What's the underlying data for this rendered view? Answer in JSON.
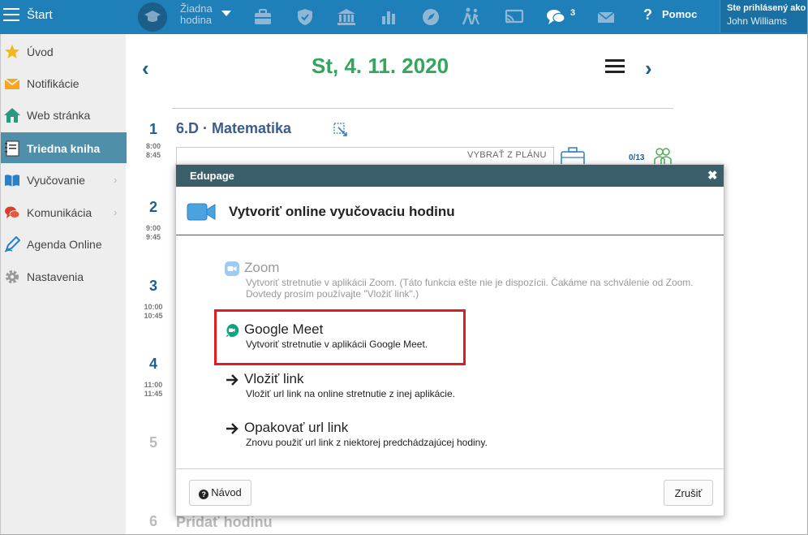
{
  "topbar": {
    "start_label": "Štart",
    "lesson_label": "Žiadna hodina",
    "chat_count": "3",
    "help_label": "Pomoc",
    "user_line1": "Ste prihlásený ako",
    "user_name": "John Williams",
    "icons": [
      "menu-icon",
      "graduation-cap-icon",
      "briefcase-icon",
      "shield-icon",
      "school-building-icon",
      "bar-chart-icon",
      "compass-icon",
      "walking-icon",
      "screen-share-icon",
      "chat-icon",
      "envelope-icon",
      "help-icon"
    ]
  },
  "sidebar": {
    "items": [
      {
        "label": "Úvod",
        "icon": "star-icon"
      },
      {
        "label": "Notifikácie",
        "icon": "envelope-icon"
      },
      {
        "label": "Web stránka",
        "icon": "home-icon"
      },
      {
        "label": "Triedna kniha",
        "icon": "notebook-icon",
        "active": true
      },
      {
        "label": "Vyučovanie",
        "icon": "book-icon",
        "chevron": "›"
      },
      {
        "label": "Komunikácia",
        "icon": "chat-icon",
        "chevron": "›"
      },
      {
        "label": "Agenda Online",
        "icon": "pen-icon"
      },
      {
        "label": "Nastavenia",
        "icon": "gear-icon"
      }
    ]
  },
  "day": {
    "prev": "‹",
    "next": "›",
    "date": "St, 4. 11. 2020",
    "periods": [
      {
        "num": "1",
        "start": "8:00",
        "end": "8:45"
      },
      {
        "num": "2",
        "start": "9:00",
        "end": "9:45"
      },
      {
        "num": "3",
        "start": "10:00",
        "end": "10:45"
      },
      {
        "num": "4",
        "start": "11:00",
        "end": "11:45"
      },
      {
        "num": "5"
      },
      {
        "num": "6"
      }
    ],
    "lesson_title": "6.D · Matematika",
    "pick_plan": "VYBRAŤ Z PLÁNU",
    "attendance": "0/13",
    "add_lesson": "Pridať hodinu"
  },
  "modal": {
    "header": "Edupage",
    "close": "✖",
    "title": "Vytvoriť online vyučovaciu hodinu",
    "options": [
      {
        "name": "Zoom",
        "desc": "Vytvoriť stretnutie v aplikácii Zoom. (Táto funkcia ešte nie je dispozícii. Čakáme na schválenie od Zoom. Dovtedy prosím používajte \"Vložiť link\".)",
        "icon": "zoom-icon",
        "enabled": false
      },
      {
        "name": "Google Meet",
        "desc": "Vytvoriť stretnutie v aplikácii Google Meet.",
        "icon": "google-meet-icon",
        "enabled": true
      },
      {
        "name": "Vložiť link",
        "desc": "Vložiť url link na online stretnutie z inej aplikácie.",
        "icon": "arrow-right-icon",
        "enabled": true
      },
      {
        "name": "Opakovať url link",
        "desc": "Znovu použiť url link z niektorej predchádzajúcej hodiny.",
        "icon": "arrow-right-icon",
        "enabled": true
      }
    ],
    "guide_button": "Návod",
    "cancel_button": "Zrušiť"
  }
}
